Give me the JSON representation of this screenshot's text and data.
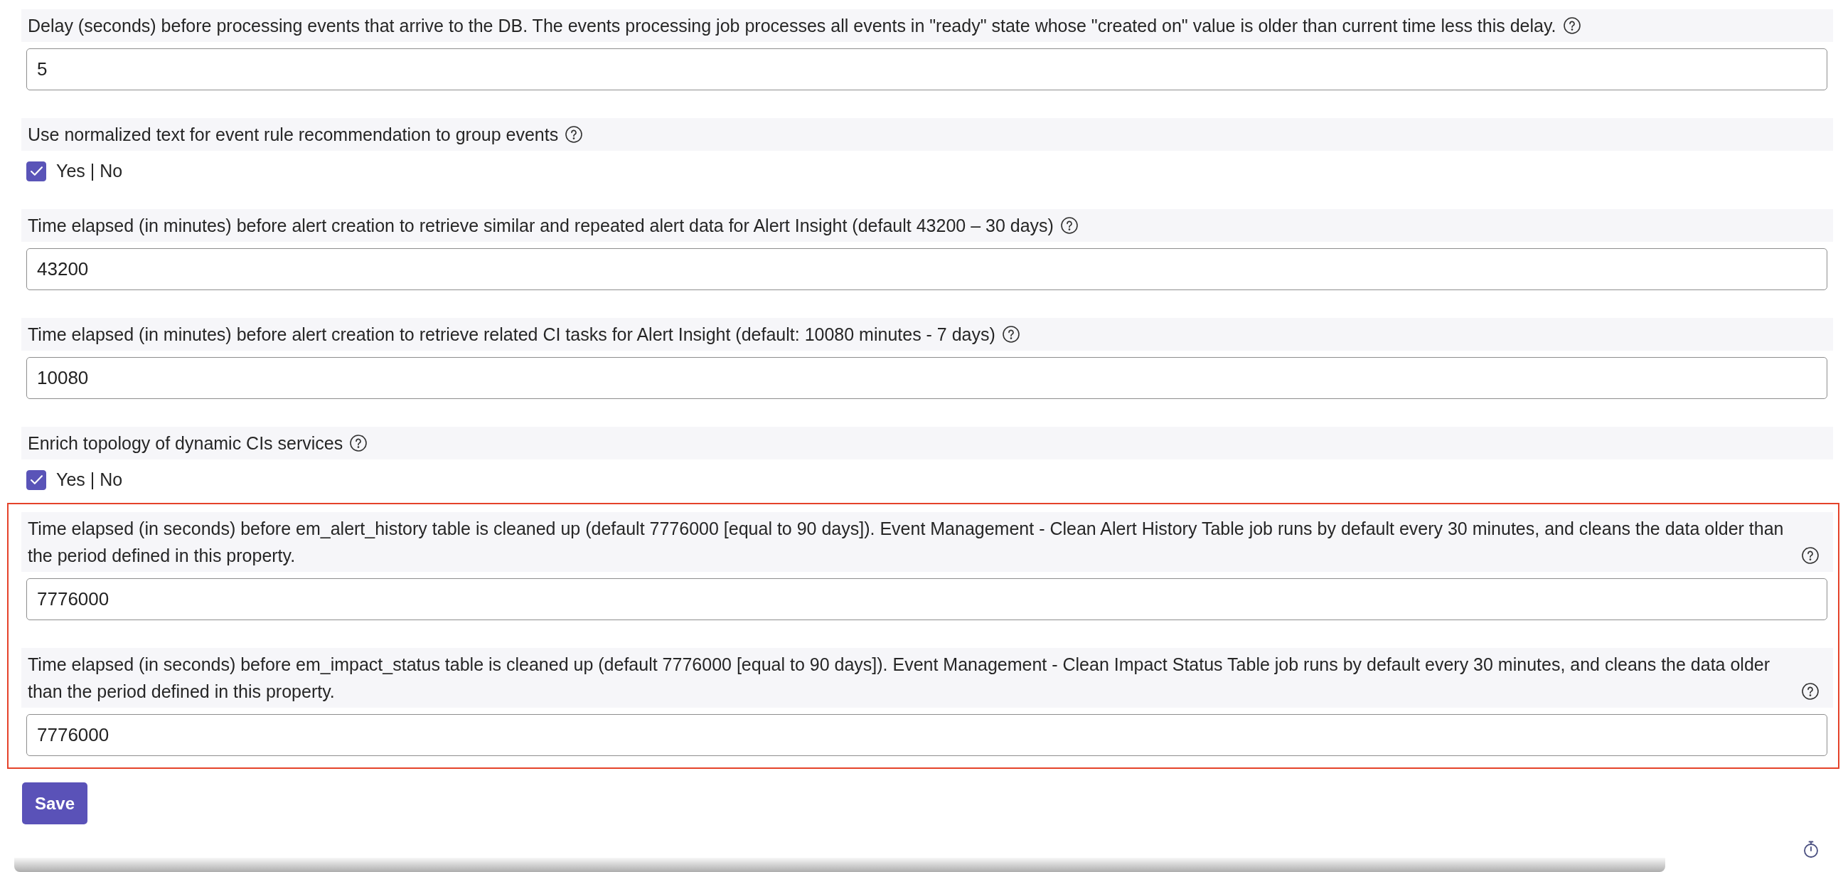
{
  "groups": [
    {
      "highlighted": false,
      "fields": [
        {
          "kind": "text",
          "label": "Delay (seconds) before processing events that arrive to the DB. The events processing job processes all events in \"ready\" state whose \"created on\" value is older than current time less this delay.",
          "value": "5"
        },
        {
          "kind": "checkbox",
          "label": "Use normalized text for event rule recommendation to group events",
          "checked": true,
          "option": "Yes | No"
        },
        {
          "kind": "text",
          "label": "Time elapsed (in minutes) before alert creation to retrieve similar and repeated alert data for Alert Insight (default 43200 – 30 days)",
          "value": "43200"
        },
        {
          "kind": "text",
          "label": "Time elapsed (in minutes) before alert creation to retrieve related CI tasks for Alert Insight (default: 10080 minutes - 7 days)",
          "value": "10080"
        },
        {
          "kind": "checkbox",
          "label": "Enrich topology of dynamic CIs services",
          "checked": true,
          "option": "Yes | No"
        }
      ]
    },
    {
      "highlighted": true,
      "fields": [
        {
          "kind": "text",
          "label": "Time elapsed (in seconds) before em_alert_history table is cleaned up (default 7776000 [equal to 90 days]). Event Management - Clean Alert History Table job runs by default every 30 minutes, and cleans the data older than the period defined in this property.",
          "value": "7776000"
        },
        {
          "kind": "text",
          "label": "Time elapsed (in seconds) before em_impact_status table is cleaned up (default 7776000 [equal to 90 days]). Event Management - Clean Impact Status Table job runs by default every 30 minutes, and cleans the data older than the period defined in this property.",
          "value": "7776000"
        }
      ]
    }
  ],
  "save_button": "Save"
}
